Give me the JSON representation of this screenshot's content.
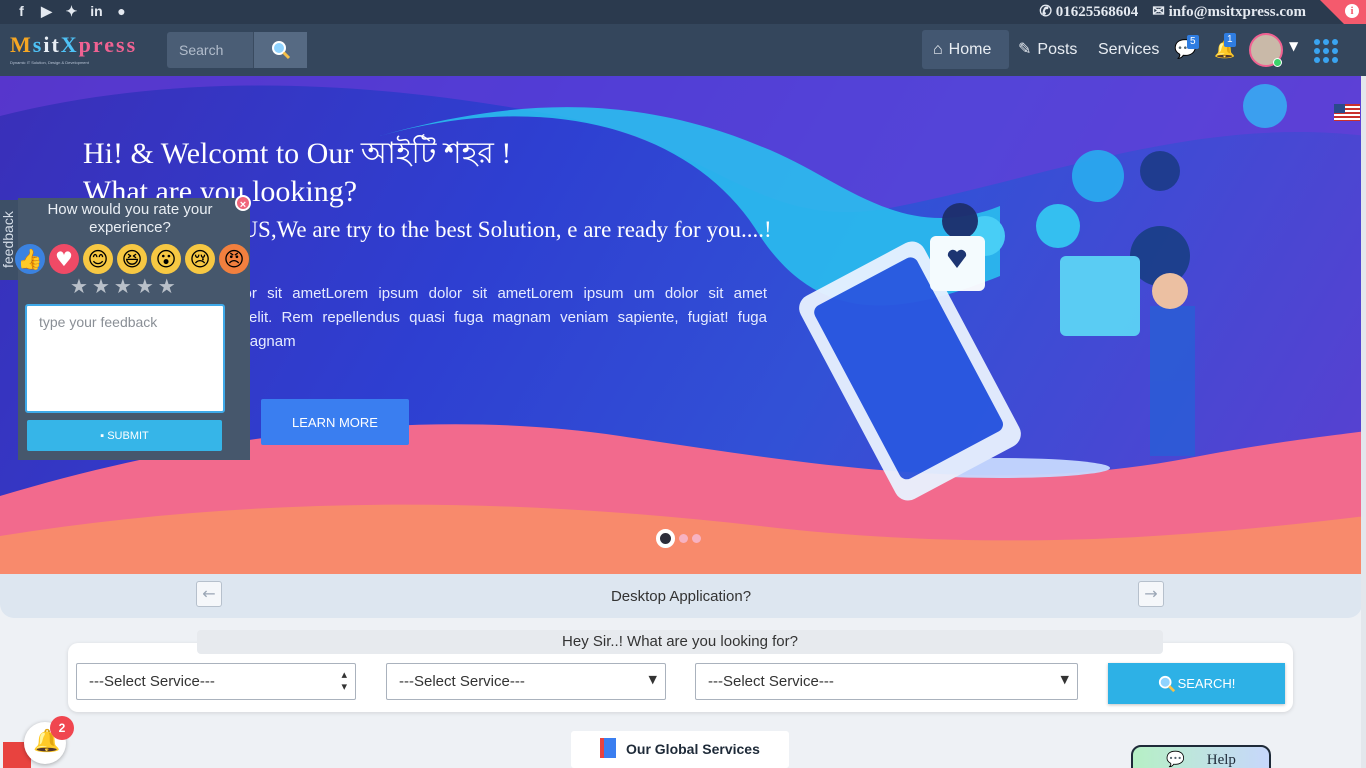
{
  "topbar": {
    "social_icons": [
      "facebook-icon",
      "youtube-icon",
      "twitter-icon",
      "linkedin-icon",
      "github-icon"
    ],
    "phone": "01625568604",
    "email": "info@msitxpress.com"
  },
  "navbar": {
    "search_placeholder": "Search",
    "home": "Home",
    "posts": "Posts",
    "services": "Services",
    "messages_count": "5",
    "notifications_count": "1"
  },
  "hero": {
    "title_line1": "Hi! & Welcomt to Our আইটি শহর !",
    "title_line2": "What are you looking?",
    "subtitle": "thing, Please tell US,We are try to the best Solution, e are ready for you....!",
    "paragraph": "amet,Lorem ipsum dolor sit ametLorem ipsum dolor sit ametLorem ipsum um dolor sit amet consectetur adipisicing elit. Rem repellendus quasi fuga magnam veniam sapiente, fugiat! fuga nesciunt dolorum nulla magnam",
    "button": "LEARN MORE"
  },
  "feedback": {
    "tab": "feedback",
    "question": "How would you rate your experience?",
    "placeholder": "type your feedback",
    "submit": "SUBMIT"
  },
  "desktop_bar": {
    "label": "Desktop Application?"
  },
  "looking_for": "Hey Sir..! What are you looking for?",
  "search_form": {
    "select1": "---Select Service---",
    "select2": "---Select Service---",
    "select3": "---Select Service---",
    "button": "SEARCH!"
  },
  "global_services": "Our Global Services",
  "help": "Help",
  "notification_badge": "2",
  "colors": {
    "primary": "#2db1e6",
    "hero_accent": "#3a7ef0",
    "navbar": "#34465c"
  }
}
